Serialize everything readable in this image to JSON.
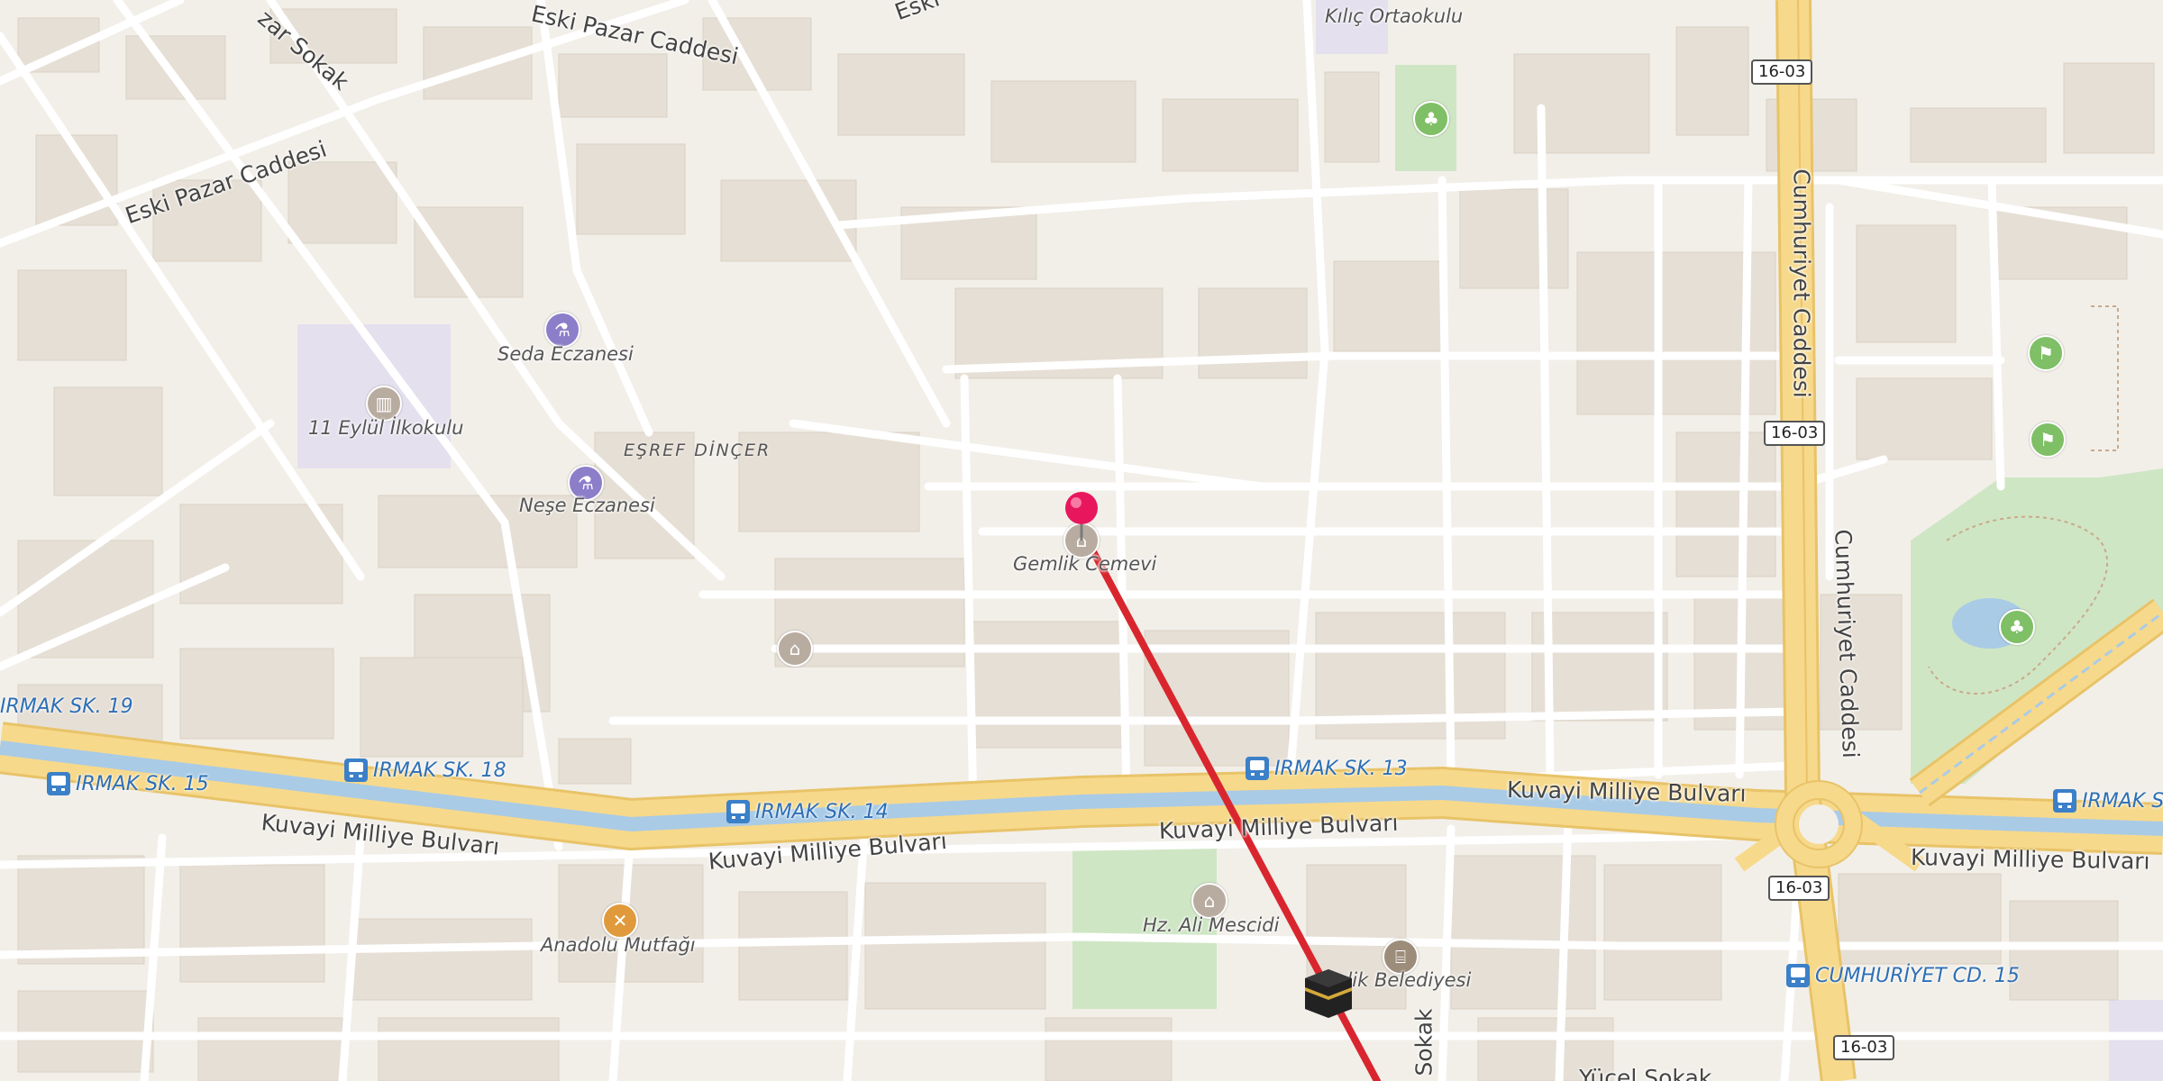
{
  "map": {
    "colors": {
      "background": "#f2efe9",
      "building": "#e6dfd5",
      "road": "#ffffff",
      "main_road": "#f7d98b",
      "canal": "#a9cbe6",
      "park": "#cfe6c4",
      "route": "#d9262e",
      "marker": "#e8175d"
    },
    "places": {
      "kilic_ortaokulu": "Kılıç Ortaokulu",
      "seda_eczanesi": "Seda Eczanesi",
      "eylul_ilkokulu": "11 Eylül İlkokulu",
      "nese_eczanesi": "Neşe Eczanesi",
      "gemlik_cemevi": "Gemlik Cemevi",
      "hz_ali_mescidi": "Hz. Ali Mescidi",
      "anadolu_mutfagi": "Anadolu Mutfağı",
      "belediyesi": "mlik Belediyesi"
    },
    "neighbourhood": "EŞREF DİNÇER",
    "streets": {
      "eski_pazar_top": "Eski Pazar Caddesi",
      "eski_pazar_left": "Eski Pazar Caddesi",
      "eski_top": "Eski",
      "sokak_top": "zar Sokak",
      "cumhuriyet_1": "Cumhuriyet Caddesi",
      "cumhuriyet_2": "Cumhuriyet Caddesi",
      "kuvayi_1": "Kuvayi Milliye Bulvarı",
      "kuvayi_2": "Kuvayi Milliye Bulvarı",
      "kuvayi_3": "Kuvayi Milliye Bulvarı",
      "kuvayi_4": "Kuvayi Milliye Bulvarı",
      "kuvayi_5": "Kuvayi Milliye Bulvarı",
      "sokak_bottom": "Sokak",
      "yucel_sokak": "Yücel Sokak"
    },
    "stops": {
      "irmak19": "IRMAK SK. 19",
      "irmak18": "IRMAK SK. 18",
      "irmak15": "IRMAK SK. 15",
      "irmak14": "IRMAK SK. 14",
      "irmak13": "IRMAK SK. 13",
      "irmak_s": "IRMAK S",
      "cumhuriyet15": "CUMHURİYET CD. 15"
    },
    "shields": {
      "s1": "16-03",
      "s2": "16-03",
      "s3": "16-03",
      "s4": "16-03"
    }
  }
}
